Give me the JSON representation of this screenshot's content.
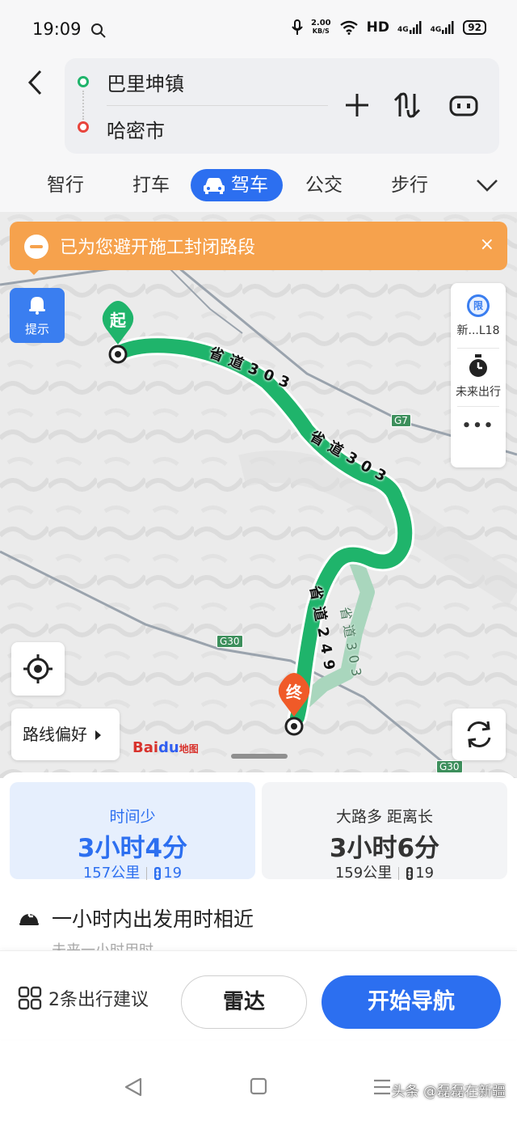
{
  "status_bar": {
    "time": "19:09",
    "net_speed_value": "2.00",
    "net_speed_unit": "KB/S",
    "hd_label": "HD",
    "signal_1": "4G",
    "signal_2": "4G",
    "battery": "92"
  },
  "route": {
    "origin": "巴里坤镇",
    "destination": "哈密市"
  },
  "tabs": [
    {
      "label": "智行"
    },
    {
      "label": "打车"
    },
    {
      "label": "驾车",
      "active": true
    },
    {
      "label": "公交"
    },
    {
      "label": "步行"
    }
  ],
  "notice": {
    "text": "已为您避开施工封闭路段",
    "close": "×"
  },
  "map": {
    "hint_label": "提示",
    "limit_badge": "限",
    "limit_label": "新...L18",
    "future_label": "未来出行",
    "more_label": "•••",
    "start_pin": "起",
    "end_pin": "终",
    "route_pref_label": "路线偏好",
    "road_labels": [
      "G7",
      "G30",
      "G30"
    ],
    "route_road_labels": [
      "省道303",
      "省道303",
      "省道249",
      "省道303"
    ],
    "logo_bai": "Bai",
    "logo_du": "du",
    "logo_map": "地图",
    "colors": {
      "route_main": "#1fb46b",
      "route_alt": "#a9d6bd",
      "start": "#1fb46b",
      "end": "#f05a28"
    }
  },
  "routes": [
    {
      "tag": "时间少",
      "time": "3小时4分",
      "distance": "157公里",
      "lights": "19",
      "selected": true
    },
    {
      "tag": "大路多  距离长",
      "time": "3小时6分",
      "distance": "159公里",
      "lights": "19",
      "selected": false
    }
  ],
  "future": {
    "title": "一小时内出发用时相近",
    "subtitle": "未来一小时用时"
  },
  "actions": {
    "suggestions": "2条出行建议",
    "radar": "雷达",
    "start_nav": "开始导航"
  },
  "watermark": "头条 @磊磊在新疆"
}
